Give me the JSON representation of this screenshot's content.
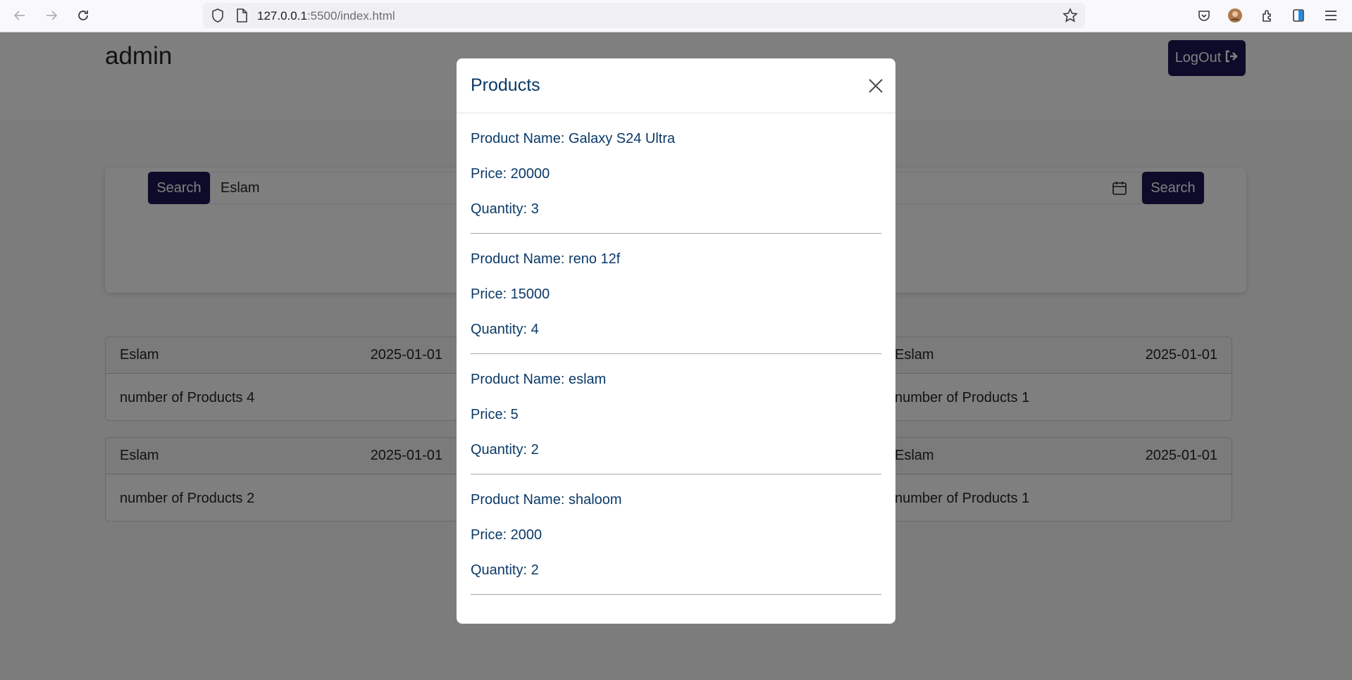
{
  "browser": {
    "url_host": "127.0.0.1",
    "url_path": ":5500/index.html"
  },
  "header": {
    "brand": "admin",
    "logout_label": "LogOut"
  },
  "search": {
    "name_button": "Search",
    "name_value": "Eslam",
    "date_button": "Search"
  },
  "orders": [
    {
      "name": "Eslam",
      "date": "2025-01-01",
      "products_text": "number of Products 4"
    },
    {
      "name": "Eslam",
      "date": "2025-01-01",
      "products_text": "number of Products 1"
    },
    {
      "name": "Eslam",
      "date": "2025-01-01",
      "products_text": "number of Products 2"
    },
    {
      "name": "Eslam",
      "date": "2025-01-01",
      "products_text": "number of Products 1"
    }
  ],
  "modal": {
    "title": "Products",
    "products": [
      {
        "name": "Product Name: Galaxy S24 Ultra",
        "price": "Price: 20000",
        "quantity": "Quantity: 3"
      },
      {
        "name": "Product Name: reno 12f",
        "price": "Price: 15000",
        "quantity": "Quantity: 4"
      },
      {
        "name": "Product Name: eslam",
        "price": "Price: 5",
        "quantity": "Quantity: 2"
      },
      {
        "name": "Product Name: shaloom",
        "price": "Price: 2000",
        "quantity": "Quantity: 2"
      }
    ]
  },
  "colors": {
    "primary_button": "#1a1652",
    "modal_text": "#0b3a68"
  }
}
